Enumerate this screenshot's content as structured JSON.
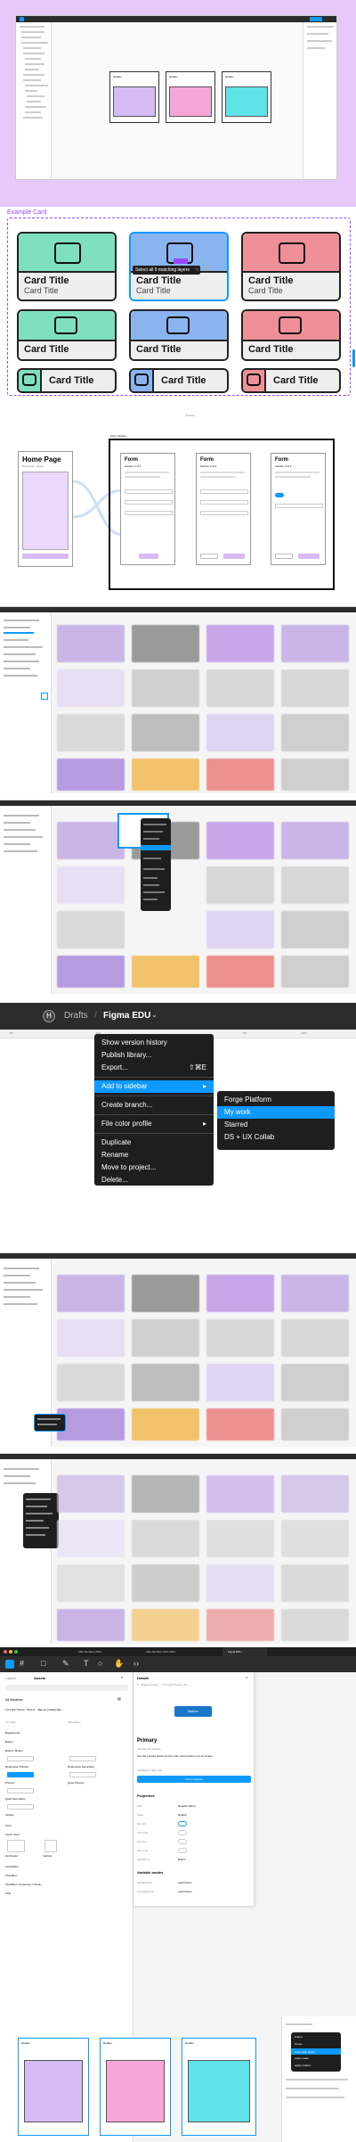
{
  "s1": {
    "frames": [
      {
        "label": "Header",
        "color": "#d6bbf5"
      },
      {
        "label": "Header",
        "color": "#f7a6d9"
      },
      {
        "label": "Header",
        "color": "#5ee3e8"
      }
    ]
  },
  "s2": {
    "component_label": "Example Card",
    "cards_row1": [
      {
        "title": "Card Title",
        "sub": "Card Title",
        "color": "#7fe0bf"
      },
      {
        "title": "Card Title",
        "sub": "Card Title",
        "color": "#8ab4f0"
      },
      {
        "title": "Card Title",
        "sub": "Card Title",
        "color": "#ef8f97"
      }
    ],
    "cards_row2": [
      {
        "title": "Card Title",
        "color": "#7fe0bf"
      },
      {
        "title": "Card Title",
        "color": "#8ab4f0"
      },
      {
        "title": "Card Title",
        "color": "#ef8f97"
      }
    ],
    "cards_row3": [
      {
        "title": "Card Title",
        "color": "#7fe0bf"
      },
      {
        "title": "Card Title",
        "color": "#8ab4f0"
      },
      {
        "title": "Card Title",
        "color": "#ef8f97"
      }
    ],
    "tooltip": "Select all 9 matching layers",
    "tooltip_shortcut": "⌥⇧⌘A",
    "bottom_label": "Instance"
  },
  "s3": {
    "home_title": "Home Page",
    "home_sub": "Description ghfirst",
    "section_label": "Form Section",
    "forms": [
      {
        "title": "Form",
        "step": "Section 1 of 3"
      },
      {
        "title": "Form",
        "step": "Section 2 of 3"
      },
      {
        "title": "Form",
        "step": "Section 3 of 3"
      }
    ]
  },
  "s6": {
    "breadcrumb_drafts": "Drafts",
    "breadcrumb_sep": "/",
    "project": "Figma EDU",
    "ruler": [
      "250",
      "500",
      "750",
      "1000"
    ],
    "menu": [
      "Show version history",
      "Publish library...",
      "Export...",
      "Add to sidebar",
      "Create branch...",
      "File color profile",
      "Duplicate",
      "Rename",
      "Move to project...",
      "Delete..."
    ],
    "export_shortcut": "⇧⌘E",
    "submenu": [
      "Forge Platform",
      "My work",
      "Starred",
      "DS + UX Collab"
    ]
  },
  "s9": {
    "tabs": [
      "Alfie Sandbox 2024",
      "Alfie Sandbox INCI 2024",
      "Figma EDU"
    ],
    "left_tabs": [
      "Layers",
      "Assets"
    ],
    "all_libraries": "All libraries",
    "library_name": "2.6 Light Theme - Web C... Banner [Cable] Ban...",
    "on_page": "On Page",
    "secondary": "Secondary",
    "items": [
      "Breadcrumb",
      "Button",
      "Button / Button",
      "Destructive Primary",
      "Destructive Secondary",
      "Primary",
      "Quiet Primary",
      "Quiet Secondary",
      "Tertiary",
      "Card",
      "Card / Card",
      "Horizontal",
      "Vertical",
      "Card Menu",
      "Checkbox",
      "Checkbox component / Check...",
      "Chip"
    ],
    "details_tab": "Details",
    "details_path": "0 - [Page of Desig... / 2.6 Light Theme - W...",
    "button_label": "Button",
    "primary_title": "Primary",
    "primary_sub": "Includes 20 variants",
    "primary_desc": "Use the primary button for the main call to action on a UI screen.",
    "updated": "Updated 11 days ago",
    "insert": "Insert instance",
    "properties": "Properties",
    "props": [
      {
        "k": "Size",
        "v": "Regular (32px)"
      },
      {
        "k": "State",
        "v": "Default"
      },
      {
        "k": "Icon left",
        "v": ""
      },
      {
        "k": "Icon right",
        "v": ""
      },
      {
        "k": "Icon top",
        "v": ""
      },
      {
        "k": "Icon only",
        "v": ""
      },
      {
        "k": "text/String",
        "v": "Button"
      }
    ],
    "variable_modes": "Variable modes",
    "modes": [
      {
        "k": "globalTheme",
        "v": "Light theme"
      },
      {
        "k": "internalTheme",
        "v": "Light theme"
      }
    ],
    "frames": [
      {
        "label": "Header",
        "color": "#d6bbf5"
      },
      {
        "label": "Header",
        "color": "#f7a6d9"
      },
      {
        "label": "Header",
        "color": "#5ee3e8"
      }
    ],
    "dropdown": [
      "Frame",
      "Group",
      "Apply auto layout",
      "Apply mask",
      "Apply rotation"
    ]
  }
}
